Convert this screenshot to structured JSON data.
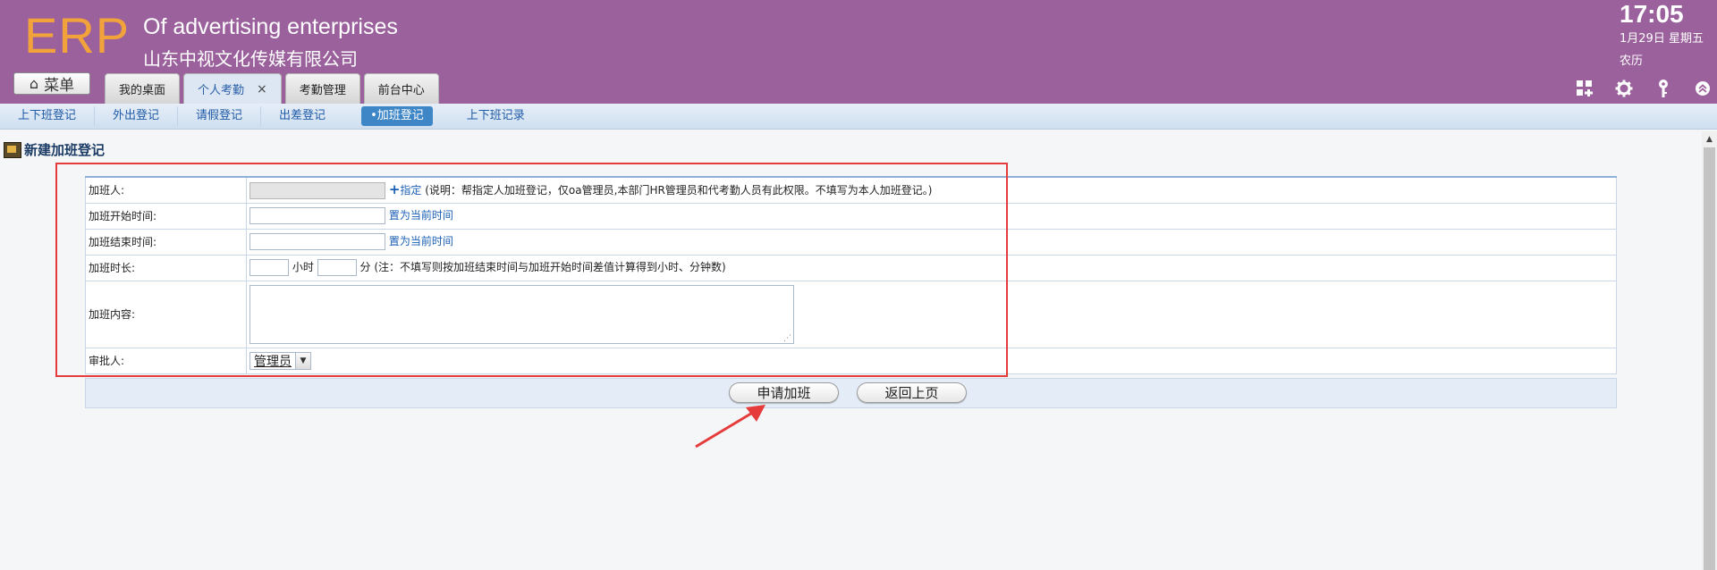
{
  "app": {
    "logo": "ERP",
    "company_en": "Of advertising enterprises",
    "company_cn": "山东中视文化传媒有限公司",
    "clock": "17:05",
    "date": "1月29日 星期五",
    "lunar": "农历"
  },
  "menu_button": {
    "icon": "home-icon",
    "label": "菜单"
  },
  "tabs": [
    {
      "label": "我的桌面"
    },
    {
      "label": "个人考勤",
      "close": "×"
    },
    {
      "label": "考勤管理"
    },
    {
      "label": "前台中心"
    }
  ],
  "header_icons": [
    "apps-icon",
    "gear-icon",
    "key-icon",
    "collapse-up-icon"
  ],
  "subnav": [
    {
      "label": "上下班登记"
    },
    {
      "label": "外出登记"
    },
    {
      "label": "请假登记"
    },
    {
      "label": "出差登记"
    },
    {
      "label": "•加班登记"
    },
    {
      "label": "上下班记录"
    }
  ],
  "page_title": "新建加班登记",
  "form": {
    "person": {
      "label": "加班人:",
      "value": "",
      "assign_link": "指定",
      "note": "(说明：帮指定人加班登记，仅oa管理员,本部门HR管理员和代考勤人员有此权限。不填写为本人加班登记。)"
    },
    "start_time": {
      "label": "加班开始时间:",
      "value": "",
      "link": "置为当前时间"
    },
    "end_time": {
      "label": "加班结束时间:",
      "value": "",
      "link": "置为当前时间"
    },
    "duration": {
      "label": "加班时长:",
      "hours_value": "",
      "hours_unit": "小时",
      "minutes_value": "",
      "minutes_unit": "分",
      "note": "(注：不填写则按加班结束时间与加班开始时间差值计算得到小时、分钟数)"
    },
    "content": {
      "label": "加班内容:",
      "value": ""
    },
    "approver": {
      "label": "审批人:",
      "selected": "管理员"
    }
  },
  "buttons": {
    "submit": "申请加班",
    "back": "返回上页"
  },
  "colors": {
    "header_bg": "#9b619d",
    "logo": "#f2a23a",
    "link": "#1b5fb4",
    "annotation_red": "#e53b3b"
  }
}
